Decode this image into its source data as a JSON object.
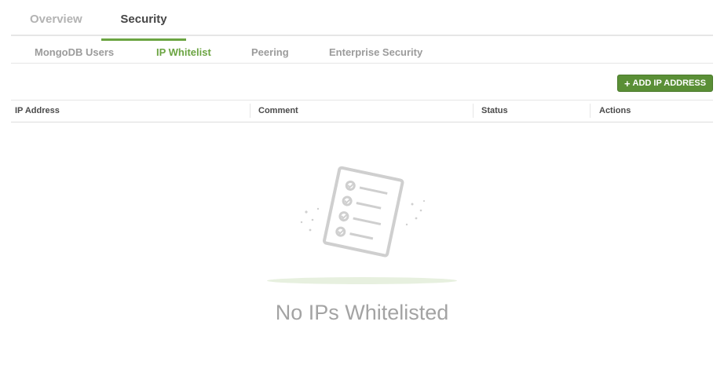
{
  "tabs": {
    "overview": "Overview",
    "security": "Security"
  },
  "subtabs": {
    "users": "MongoDB Users",
    "whitelist": "IP Whitelist",
    "peering": "Peering",
    "enterprise": "Enterprise Security"
  },
  "toolbar": {
    "add_label": "ADD IP ADDRESS",
    "add_icon": "+"
  },
  "table": {
    "columns": [
      "IP Address",
      "Comment",
      "Status",
      "Actions"
    ]
  },
  "empty_state": {
    "message": "No IPs Whitelisted",
    "icon": "checklist-document-icon"
  },
  "colors": {
    "accent": "#6ba442",
    "button": "#5a8f36"
  }
}
